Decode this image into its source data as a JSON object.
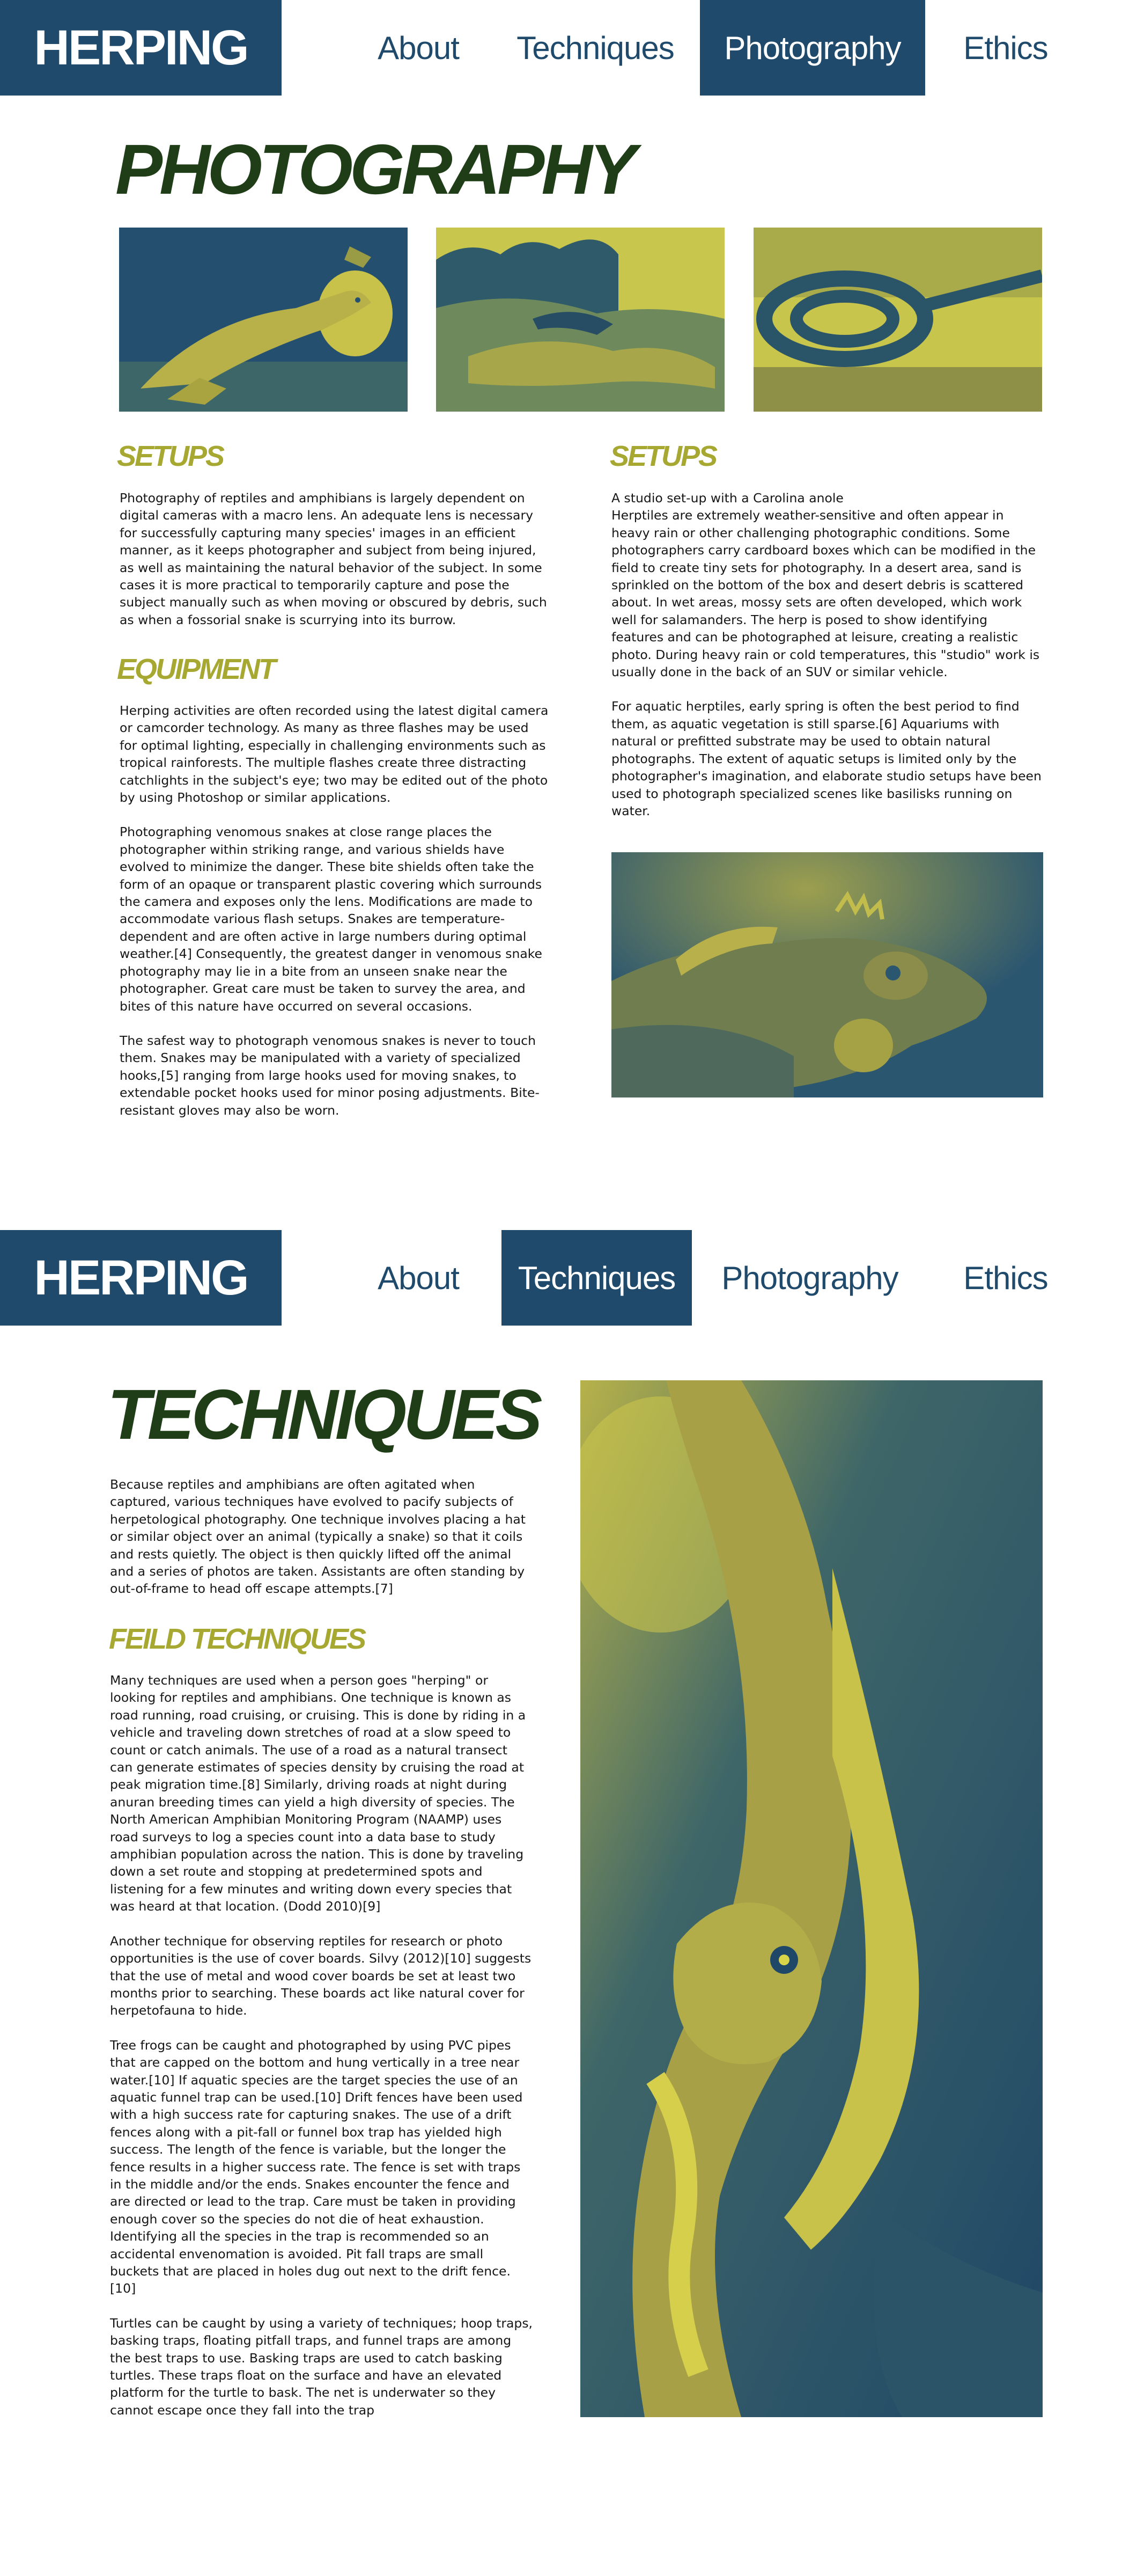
{
  "brand": "HERPING",
  "nav": {
    "about": "About",
    "techniques": "Techniques",
    "photography": "Photography",
    "ethics": "Ethics"
  },
  "colors": {
    "navy": "#1f4a6b",
    "title_green": "#1f3d17",
    "heading_olive": "#a6a832",
    "duotone_dark": "#224c6a",
    "duotone_light": "#d8d44a"
  },
  "photography": {
    "title": "PHOTOGRAPHY",
    "left": {
      "setups_heading": "SETUPS",
      "setups_text": "Photography of reptiles and amphibians is largely dependent on digital cameras with a macro lens. An adequate lens is necessary for successfully capturing many species' images in an efficient manner, as it keeps photographer and subject from being injured, as well as maintaining the natural behavior of the subject. In some cases it is more practical to temporarily capture and pose the subject manually such as when moving or obscured by debris, such as when a fossorial snake is scurrying into its burrow.",
      "equipment_heading": "EQUIPMENT",
      "equipment_p1": "Herping activities are often recorded using the latest digital camera or camcorder technology. As many as three flashes may be used for optimal lighting, especially in challenging environments such as tropical rainforests. The multiple flashes create three distracting catchlights in the subject's eye; two may be edited out of the photo by using Photoshop or similar applications.",
      "equipment_p2": "Photographing venomous snakes at close range places the photographer within striking range, and various shields have evolved to minimize the danger. These bite shields often take the form of an opaque or transparent plastic covering which surrounds the camera and exposes only the lens. Modifications are made to accommodate various flash setups. Snakes are temperature-dependent and are often active in large numbers during optimal weather.[4] Consequently, the greatest danger in venomous snake photography may lie in a bite from an unseen snake near the photographer. Great care must be taken to survey the area, and bites of this nature have occurred on several occasions.",
      "equipment_p3": "The safest way to photograph venomous snakes is never to touch them. Snakes may be manipulated with a variety of specialized hooks,[5] ranging from large hooks used for moving snakes, to extendable pocket hooks used for minor posing adjustments. Bite-resistant gloves may also be worn."
    },
    "right": {
      "setups_heading": "SETUPS",
      "caption": "A studio set-up with a Carolina anole",
      "setups_p1": "Herptiles are extremely weather-sensitive and often appear in heavy rain or other challenging photographic conditions. Some photographers carry cardboard boxes which can be modified in the field to create tiny sets for photography. In a desert area, sand is sprinkled on the bottom of the box and desert debris is scattered about. In wet areas, mossy sets are often developed, which work well for salamanders. The herp is posed to show identifying features and can be photographed at leisure, creating a realistic photo. During heavy rain or cold temperatures, this \"studio\" work is usually done in the back of an SUV or similar vehicle.",
      "setups_p2": "For aquatic herptiles, early spring is often the best period to find them, as aquatic vegetation is still sparse.[6] Aquariums with natural or prefitted substrate may be used to obtain natural photographs. The extent of aquatic setups is limited only by the photographer's imagination, and elaborate studio setups have been used to photograph specialized scenes like basilisks running on water."
    }
  },
  "techniques": {
    "title": "TECHNIQUES",
    "intro": "Because reptiles and amphibians are often agitated when captured, various techniques have evolved to pacify subjects of herpetological photography. One technique involves placing a hat or similar object over an animal (typically a snake) so that it coils and rests quietly. The object is then quickly lifted off the animal and a series of photos are taken. Assistants are often standing by out-of-frame to head off escape attempts.[7]",
    "field_heading": "FEILD TECHNIQUES",
    "p1": "Many techniques are used when a person goes \"herping\" or looking for reptiles and amphibians. One technique is known as road running, road cruising, or cruising. This is done by riding in a vehicle and traveling down stretches of road at a slow speed to count or catch animals. The use of a road as a natural transect can generate estimates of species density by cruising the road at peak migration time.[8] Similarly, driving roads at night during anuran breeding times can yield a high diversity of species. The North American Amphibian Monitoring Program (NAAMP) uses road surveys to log a species count into a data base to study amphibian population across the nation. This is done by traveling down a set route and stopping at predetermined spots and listening for a few minutes and writing down every species that was heard at that location. (Dodd 2010)[9]",
    "p2": "Another technique for observing reptiles for research or photo opportunities is the use of cover boards. Silvy (2012)[10] suggests that the use of metal and wood cover boards be set at least two months prior to searching. These boards act like natural cover for herpetofauna to hide.",
    "p3": "Tree frogs can be caught and photographed by using PVC pipes that are capped on the bottom and hung vertically in a tree near water.[10] If aquatic species are the target species the use of an aquatic funnel trap can be used.[10] Drift fences have been used with a high success rate for capturing snakes. The use of a drift fences along with a pit-fall or funnel box trap has yielded high success. The length of the fence is variable, but the longer the fence results in a higher success rate. The fence is set with traps in the middle and/or the ends. Snakes encounter the fence and are directed or lead to the trap. Care must be taken in providing enough cover so the species do not die of heat exhaustion. Identifying all the species in the trap is recommended so an accidental envenomation is avoided. Pit fall traps are small buckets that are placed in holes dug out next to the drift fence.[10]",
    "p4": "Turtles can be caught by using a variety of techniques; hoop traps, basking traps, floating pitfall traps, and funnel traps are among the best traps to use. Basking traps are used to catch basking turtles. These traps float on the surface and have an elevated platform for the turtle to bask. The net is underwater so they cannot escape once they fall into the trap"
  }
}
